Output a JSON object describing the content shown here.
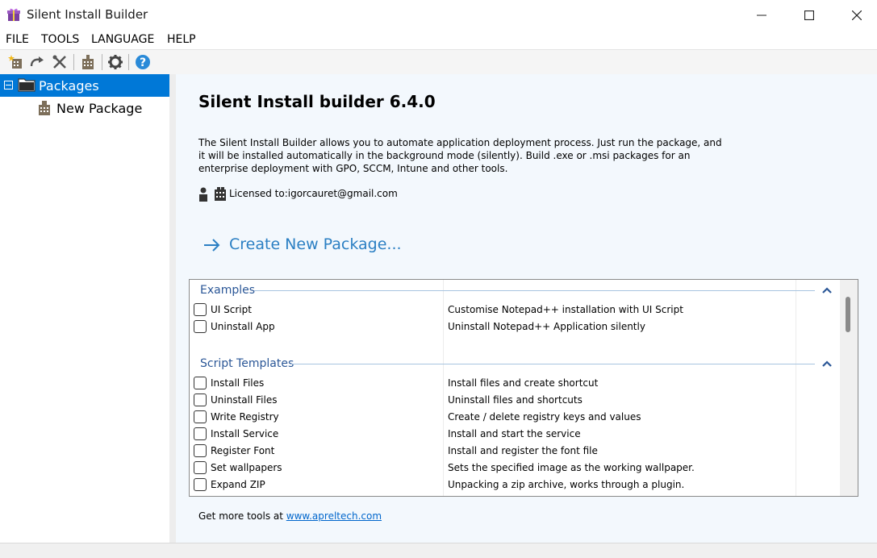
{
  "window": {
    "title": "Silent Install Builder"
  },
  "menu": [
    "FILE",
    "TOOLS",
    "LANGUAGE",
    "HELP"
  ],
  "toolbar": {
    "icons": [
      "new-package-icon",
      "redo-icon",
      "tools-icon",
      "build-icon",
      "settings-icon",
      "help-icon"
    ]
  },
  "tree": {
    "root": "Packages",
    "children": [
      "New Package"
    ]
  },
  "content": {
    "heading": "Silent Install builder 6.4.0",
    "description": "The Silent Install Builder allows you to automate application deployment process. Just run the package, and it will be installed automatically in the background mode (silently).  Build .exe or .msi packages for an enterprise deployment with GPO, SCCM, Intune and other tools.",
    "license": "Licensed to:igorcauret@gmail.com",
    "create_link": "Create New Package..."
  },
  "groups": [
    {
      "title": "Examples",
      "items": [
        {
          "name": "UI Script",
          "desc": "Customise Notepad++ installation with UI Script"
        },
        {
          "name": "Uninstall App",
          "desc": "Uninstall Notepad++ Application silently"
        }
      ]
    },
    {
      "title": "Script Templates",
      "items": [
        {
          "name": "Install Files",
          "desc": "Install files and create shortcut"
        },
        {
          "name": "Uninstall Files",
          "desc": "Uninstall files and shortcuts"
        },
        {
          "name": "Write Registry",
          "desc": "Create / delete registry keys and values"
        },
        {
          "name": "Install Service",
          "desc": "Install and start the service"
        },
        {
          "name": "Register Font",
          "desc": "Install and register the font file"
        },
        {
          "name": "Set wallpapers",
          "desc": "Sets the specified image as the working wallpaper."
        },
        {
          "name": "Expand ZIP",
          "desc": "Unpacking a zip archive, works through a plugin."
        }
      ]
    }
  ],
  "footer": {
    "prefix": "Get more tools at ",
    "link": "www.apreltech.com"
  },
  "colors": {
    "selection": "#0078d7",
    "link": "#2b7fc3",
    "group_title": "#2b5797"
  }
}
